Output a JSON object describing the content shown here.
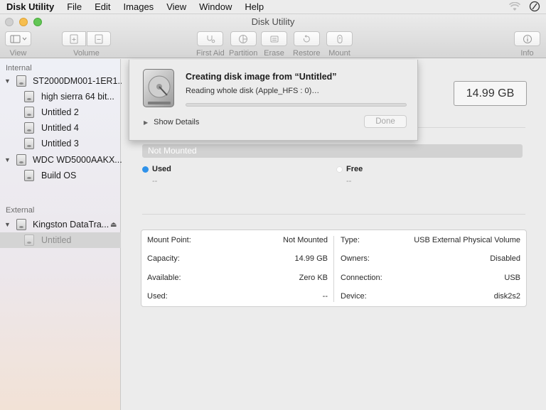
{
  "menubar": {
    "app": "Disk Utility",
    "items": [
      "File",
      "Edit",
      "Images",
      "View",
      "Window",
      "Help"
    ]
  },
  "window": {
    "title": "Disk Utility"
  },
  "toolbar": {
    "view": "View",
    "volume": "Volume",
    "first_aid": "First Aid",
    "partition": "Partition",
    "erase": "Erase",
    "restore": "Restore",
    "mount": "Mount",
    "info": "Info"
  },
  "sidebar": {
    "internal_label": "Internal",
    "external_label": "External",
    "items": [
      {
        "label": "ST2000DM001-1ER1...",
        "type": "disk"
      },
      {
        "label": "high sierra 64 bit...",
        "type": "volume"
      },
      {
        "label": "Untitled 2",
        "type": "volume"
      },
      {
        "label": "Untitled 4",
        "type": "volume"
      },
      {
        "label": "Untitled 3",
        "type": "volume"
      },
      {
        "label": "WDC WD5000AAKX...",
        "type": "disk"
      },
      {
        "label": "Build OS",
        "type": "volume"
      },
      {
        "label": "Kingston DataTra...",
        "type": "disk"
      },
      {
        "label": "Untitled",
        "type": "volume",
        "selected": true
      }
    ]
  },
  "sheet": {
    "title": "Creating disk image from “Untitled”",
    "subtitle": "Reading whole disk (Apple_HFS : 0)…",
    "progress": 0,
    "show_details": "Show Details",
    "done": "Done"
  },
  "main": {
    "capacity": "14.99 GB",
    "bar_label": "Not Mounted",
    "used_label": "Used",
    "used_value": "--",
    "free_label": "Free",
    "free_value": "--",
    "used_color": "#2f92ea",
    "info": {
      "left": [
        {
          "key": "Mount Point:",
          "value": "Not Mounted"
        },
        {
          "key": "Capacity:",
          "value": "14.99 GB"
        },
        {
          "key": "Available:",
          "value": "Zero KB"
        },
        {
          "key": "Used:",
          "value": "--"
        }
      ],
      "right": [
        {
          "key": "Type:",
          "value": "USB External Physical Volume"
        },
        {
          "key": "Owners:",
          "value": "Disabled"
        },
        {
          "key": "Connection:",
          "value": "USB"
        },
        {
          "key": "Device:",
          "value": "disk2s2"
        }
      ]
    }
  }
}
